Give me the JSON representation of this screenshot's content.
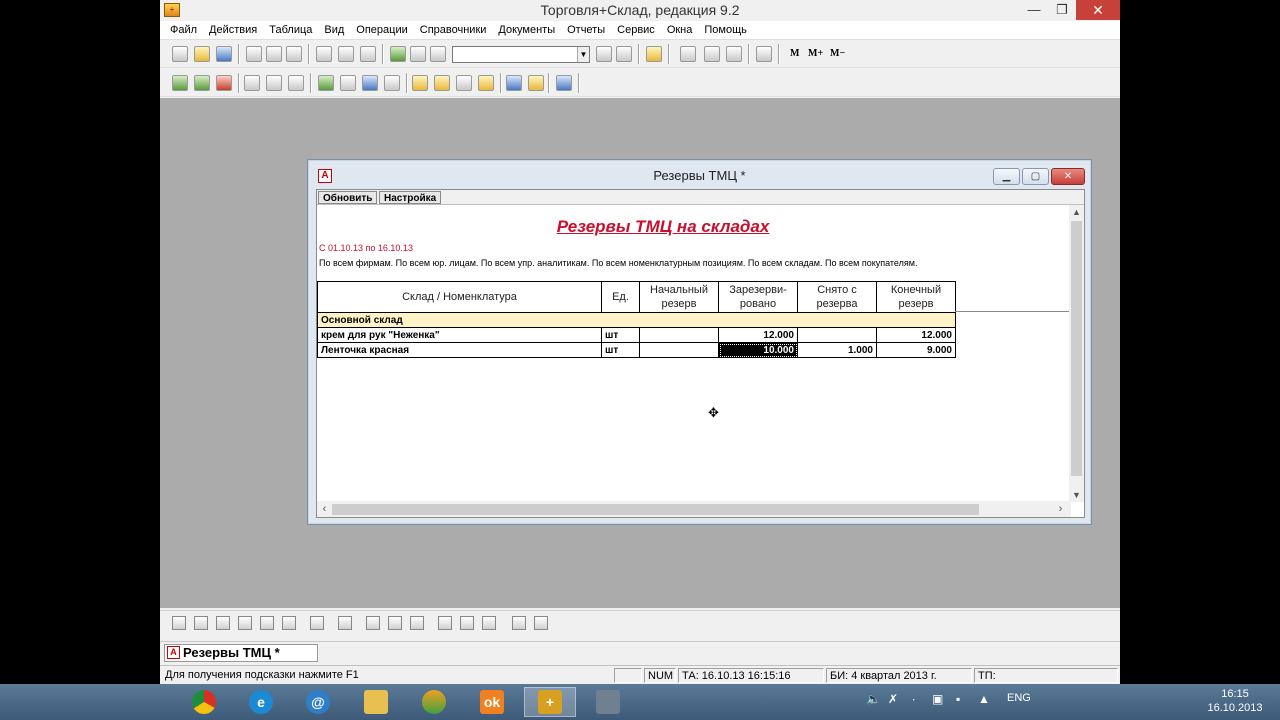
{
  "app": {
    "title": "Торговля+Склад, редакция 9.2",
    "window_controls": {
      "minimize": "—",
      "restore": "❐",
      "close": "✕"
    }
  },
  "menu": [
    "Файл",
    "Действия",
    "Таблица",
    "Вид",
    "Операции",
    "Справочники",
    "Документы",
    "Отчеты",
    "Сервис",
    "Окна",
    "Помощь"
  ],
  "toolbar": {
    "mem_m": "M",
    "mem_mplus": "M+",
    "mem_mminus": "M−",
    "combo_value": ""
  },
  "child_window": {
    "title": "Резервы ТМЦ  *",
    "buttons": {
      "refresh": "Обновить",
      "settings": "Настройка"
    }
  },
  "report": {
    "title": "Резервы ТМЦ на складах",
    "period": "С 01.10.13 по 16.10.13",
    "filter": "По всем фирмам. По всем юр. лицам. По всем упр. аналитикам. По всем номенклатурным позициям. По всем складам. По всем покупателям.",
    "columns": [
      "Склад / Номенклатура",
      "Ед.",
      "Начальный резерв",
      "Зарезерви-рован­о",
      "Снято с резерва",
      "Конечный резерв"
    ],
    "column_labels": {
      "name": "Склад / Номенклатура",
      "unit": "Ед.",
      "initial": "Начальный резерв",
      "reserved": "Зарезерви-ровано",
      "removed": "Снято с резерва",
      "final": "Конечный резерв"
    },
    "group": "Основной склад",
    "rows": [
      {
        "name": "крем для рук \"Неженка\"",
        "unit": "шт",
        "initial": "",
        "reserved": "12.000",
        "removed": "",
        "final": "12.000"
      },
      {
        "name": "Ленточка красная",
        "unit": "шт",
        "initial": "",
        "reserved": "10.000",
        "removed": "1.000",
        "final": "9.000"
      }
    ]
  },
  "window_tab": "Резервы ТМЦ  *",
  "status": {
    "hint": "Для получения подсказки нажмите F1",
    "num": "NUM",
    "ta": "ТА: 16.10.13  16:15:16",
    "bi": "БИ: 4 квартал 2013 г.",
    "tp": "ТП:"
  },
  "taskbar": {
    "lang": "ENG",
    "time": "16:15",
    "date": "16.10.2013"
  }
}
